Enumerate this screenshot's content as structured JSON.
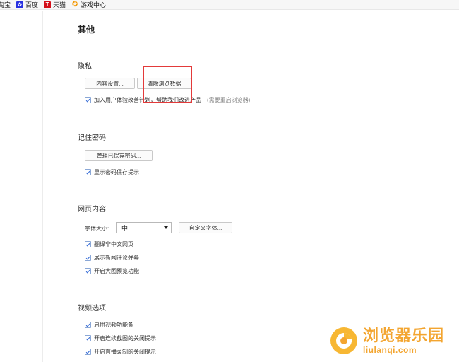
{
  "bookmarks": {
    "items": [
      {
        "label": "淘宝",
        "icon": "taobao-partial"
      },
      {
        "label": "百度",
        "icon": "baidu-paw-icon"
      },
      {
        "label": "天猫",
        "icon": "tmall-icon"
      },
      {
        "label": "游戏中心",
        "icon": "game-center-icon"
      }
    ]
  },
  "page": {
    "title": "其他"
  },
  "privacy": {
    "title": "隐私",
    "content_settings_label": "内容设置...",
    "clear_data_label": "清除浏览数据",
    "ux_program_label": "加入用户体验改善计划，帮助我们改进产品",
    "ux_program_hint": "(需要重启浏览器)"
  },
  "passwords": {
    "title": "记住密码",
    "manage_label": "管理已保存密码...",
    "show_prompt_label": "显示密码保存提示"
  },
  "web_content": {
    "title": "网页内容",
    "font_size_label": "字体大小:",
    "font_size_value": "中",
    "custom_font_label": "自定义字体...",
    "translate_label": "翻译非中文网页",
    "news_comments_label": "展示新闻评论弹幕",
    "image_preview_label": "开启大图预览功能"
  },
  "video": {
    "title": "视频选项",
    "toolbar_label": "启用视频功能条",
    "screenshot_prompt_label": "开启连续截图的关闭提示",
    "recording_prompt_label": "开启直播录制的关闭提示"
  },
  "watermark": {
    "cn": "浏览器乐园",
    "en": "liulanqi.com"
  },
  "colors": {
    "accent": "#3a6fd8",
    "highlight": "#e33a3a",
    "watermark": "#f3a530"
  }
}
